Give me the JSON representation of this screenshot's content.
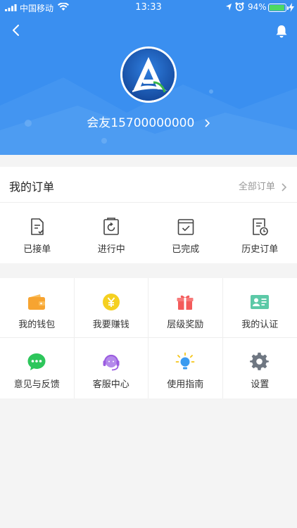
{
  "status_bar": {
    "carrier": "中国移动",
    "time": "13:33",
    "battery_percent": "94%",
    "battery_level": 0.94
  },
  "profile": {
    "name": "会友15700000000"
  },
  "orders": {
    "title": "我的订单",
    "view_all": "全部订单",
    "items": [
      {
        "label": "已接单",
        "icon": "received-order-icon"
      },
      {
        "label": "进行中",
        "icon": "in-progress-icon"
      },
      {
        "label": "已完成",
        "icon": "completed-icon"
      },
      {
        "label": "历史订单",
        "icon": "history-orders-icon"
      }
    ]
  },
  "services": [
    {
      "label": "我的钱包",
      "icon": "wallet-icon",
      "color": "#f7a431"
    },
    {
      "label": "我要赚钱",
      "icon": "yuan-coin-icon",
      "color": "#f5d020"
    },
    {
      "label": "层级奖励",
      "icon": "gift-icon",
      "color": "#f35b5b"
    },
    {
      "label": "我的认证",
      "icon": "id-card-icon",
      "color": "#5cc9a7"
    },
    {
      "label": "意见与反馈",
      "icon": "chat-bubble-icon",
      "color": "#2dc65b"
    },
    {
      "label": "客服中心",
      "icon": "headset-icon",
      "color": "#9b5ce0"
    },
    {
      "label": "使用指南",
      "icon": "lightbulb-icon",
      "color": "#3a9bf0"
    },
    {
      "label": "设置",
      "icon": "gear-icon",
      "color": "#6f7782"
    }
  ],
  "colors": {
    "header_bg": "#3a8ff0",
    "page_bg": "#f4f4f4"
  }
}
